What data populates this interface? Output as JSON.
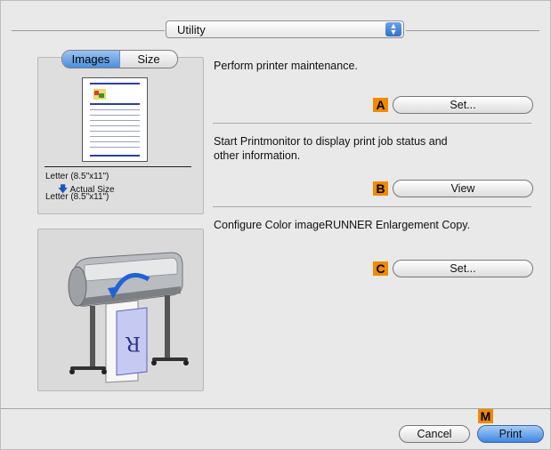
{
  "utility_popup": {
    "label": "Utility"
  },
  "preview": {
    "tabs": [
      {
        "label": "Images",
        "selected": true
      },
      {
        "label": "Size",
        "selected": false
      }
    ],
    "paper_size_top": "Letter (8.5\"x11\")",
    "scale_label": "Actual Size",
    "paper_size_bottom": "Letter (8.5\"x11\")"
  },
  "sections": [
    {
      "description": "Perform printer maintenance.",
      "badge": "A",
      "button_label": "Set..."
    },
    {
      "description_line1": "Start Printmonitor to display print job status and",
      "description_line2": "other information.",
      "badge": "B",
      "button_label": "View"
    },
    {
      "description": "Configure Color imageRUNNER Enlargement Copy.",
      "badge": "C",
      "button_label": "Set..."
    }
  ],
  "footer": {
    "badge": "M",
    "cancel_label": "Cancel",
    "print_label": "Print"
  },
  "colors": {
    "badge": "#f08a00",
    "accent_blue": "#3f86e3"
  }
}
